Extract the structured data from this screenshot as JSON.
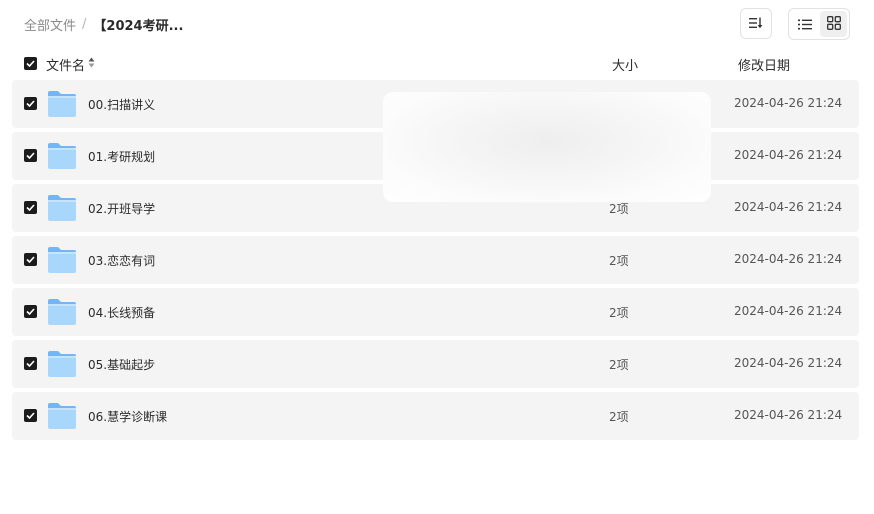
{
  "breadcrumb": {
    "root": "全部文件",
    "separator": "/",
    "current": "【2024考研..."
  },
  "toolbar": {
    "sort_icon": "sort-icon",
    "list_view_icon": "list-view-icon",
    "grid_view_icon": "grid-view-icon",
    "active_view": "list"
  },
  "header": {
    "name": "文件名",
    "size": "大小",
    "date": "修改日期",
    "all_selected": true
  },
  "files": [
    {
      "name": "00.扫描讲义",
      "size": "",
      "date": "2024-04-26 21:24",
      "selected": true
    },
    {
      "name": "01.考研规划",
      "size": "",
      "date": "2024-04-26 21:24",
      "selected": true
    },
    {
      "name": "02.开班导学",
      "size": "2项",
      "date": "2024-04-26 21:24",
      "selected": true
    },
    {
      "name": "03.恋恋有词",
      "size": "2项",
      "date": "2024-04-26 21:24",
      "selected": true
    },
    {
      "name": "04.长线预备",
      "size": "2项",
      "date": "2024-04-26 21:24",
      "selected": true
    },
    {
      "name": "05.基础起步",
      "size": "2项",
      "date": "2024-04-26 21:24",
      "selected": true
    },
    {
      "name": "06.慧学诊断课",
      "size": "2项",
      "date": "2024-04-26 21:24",
      "selected": true
    }
  ],
  "colors": {
    "row_background": "#f4f4f4",
    "checkbox": "#1c1c1c",
    "folder_light": "#a9d6fb",
    "folder_dark": "#74b6f2"
  }
}
